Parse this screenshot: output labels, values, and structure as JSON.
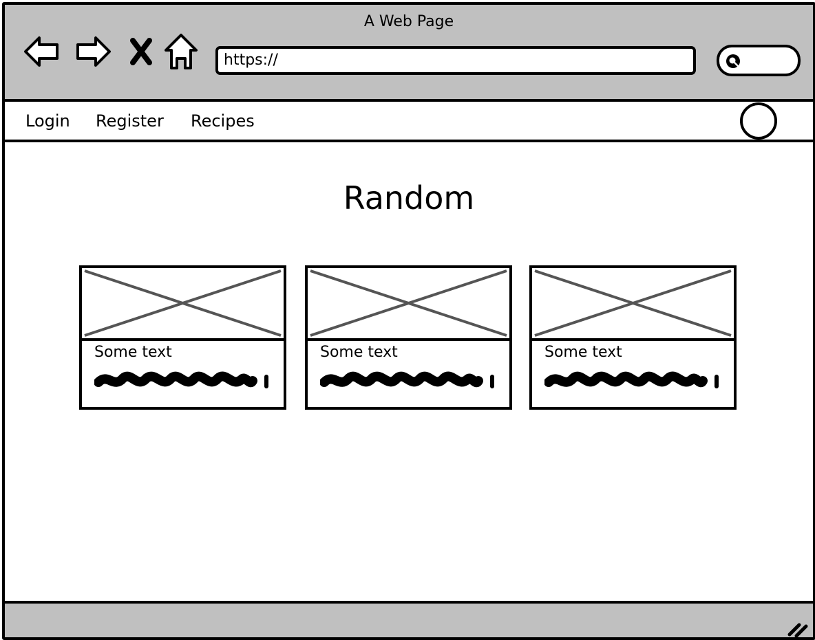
{
  "window": {
    "title": "A Web Page"
  },
  "toolbar": {
    "back_icon": "back-arrow-icon",
    "forward_icon": "forward-arrow-icon",
    "stop_icon": "close-icon",
    "home_icon": "home-icon",
    "url": "https://",
    "search_icon": "search-icon"
  },
  "nav": {
    "links": [
      "Login",
      "Register",
      "Recipes"
    ],
    "avatar_icon": "avatar-circle"
  },
  "main": {
    "title": "Random",
    "cards": [
      {
        "text": "Some text",
        "image_icon": "image-placeholder-icon"
      },
      {
        "text": "Some text",
        "image_icon": "image-placeholder-icon"
      },
      {
        "text": "Some text",
        "image_icon": "image-placeholder-icon"
      }
    ]
  },
  "colors": {
    "chrome": "#c0c0c0",
    "border": "#000000",
    "placeholder_cross": "#555555"
  }
}
